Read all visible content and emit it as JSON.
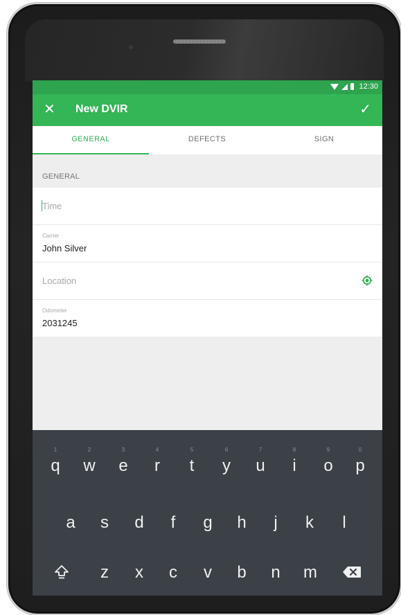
{
  "status_bar": {
    "time": "12:30",
    "icons": [
      "wifi-icon",
      "signal-icon",
      "battery-icon"
    ]
  },
  "app_bar": {
    "close_icon": "✕",
    "title": "New DVIR",
    "check_icon": "✓"
  },
  "tabs": [
    {
      "label": "GENERAL",
      "selected": true
    },
    {
      "label": "DEFECTS",
      "selected": false
    },
    {
      "label": "SIGN",
      "selected": false
    }
  ],
  "section": {
    "header": "GENERAL"
  },
  "form": {
    "time": {
      "placeholder": "Time",
      "value": ""
    },
    "carrier": {
      "label": "Carrier",
      "value": "John Silver"
    },
    "location": {
      "placeholder": "Location",
      "value": "",
      "icon": "my-location-icon"
    },
    "odometer": {
      "label": "Odometer",
      "value": "2031245"
    }
  },
  "keyboard": {
    "row1": [
      {
        "num": "1",
        "ch": "q"
      },
      {
        "num": "2",
        "ch": "w"
      },
      {
        "num": "3",
        "ch": "e"
      },
      {
        "num": "4",
        "ch": "r"
      },
      {
        "num": "5",
        "ch": "t"
      },
      {
        "num": "6",
        "ch": "y"
      },
      {
        "num": "7",
        "ch": "u"
      },
      {
        "num": "8",
        "ch": "i"
      },
      {
        "num": "9",
        "ch": "o"
      },
      {
        "num": "0",
        "ch": "p"
      }
    ],
    "row2": [
      "a",
      "s",
      "d",
      "f",
      "g",
      "h",
      "j",
      "k",
      "l"
    ],
    "row3": [
      "z",
      "x",
      "c",
      "v",
      "b",
      "n",
      "m"
    ],
    "shift_icon": "shift-icon",
    "backspace_icon": "backspace-icon"
  },
  "colors": {
    "status_bar": "#2ea44f",
    "app_bar": "#34b556",
    "accent": "#34b556",
    "keyboard_bg": "#3b4147"
  }
}
